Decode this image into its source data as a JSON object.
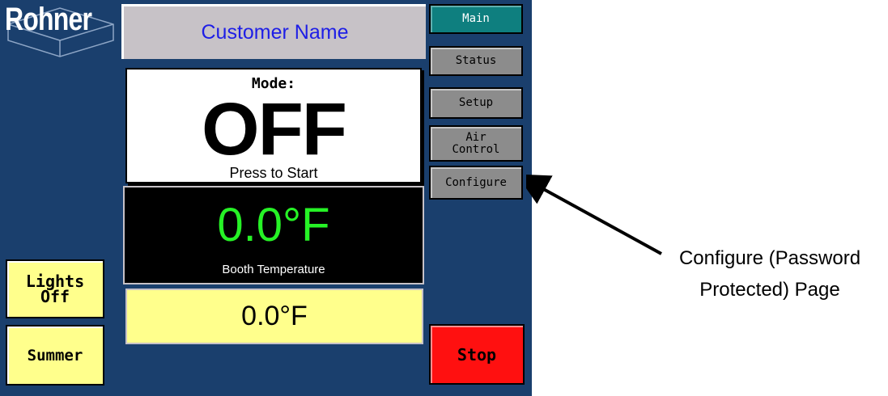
{
  "logo": {
    "text": "Rohner"
  },
  "header": {
    "customer_name": "Customer Name"
  },
  "mode": {
    "label": "Mode:",
    "value": "OFF",
    "hint": "Press to Start"
  },
  "booth": {
    "temperature": "0.0°F",
    "label": "Booth Temperature"
  },
  "setpoint": {
    "value": "0.0°F"
  },
  "nav": {
    "main": "Main",
    "status": "Status",
    "setup": "Setup",
    "air_control_line1": "Air",
    "air_control_line2": "Control",
    "configure": "Configure"
  },
  "side": {
    "lights_line1": "Lights",
    "lights_line2": "Off",
    "summer": "Summer"
  },
  "stop": {
    "label": "Stop"
  },
  "annotation": {
    "line1": "Configure (Password",
    "line2": "Protected) Page"
  },
  "colors": {
    "panel_bg": "#1a3f6d",
    "active_nav": "#0e7f7f",
    "inactive_nav": "#8c8c8c",
    "yellow_button": "#ffff8c",
    "stop_red": "#ff1010",
    "temp_green": "#26f226",
    "customer_text": "#1e1ee6"
  }
}
